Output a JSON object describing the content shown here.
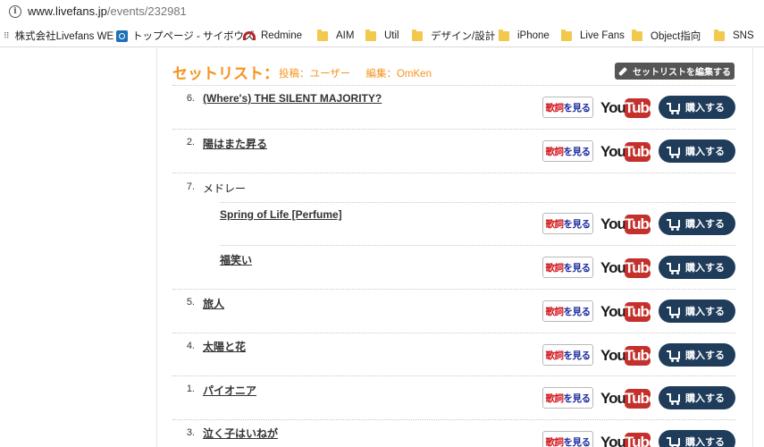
{
  "address_bar": {
    "url_domain": "www.livefans.jp",
    "url_path": "/events/232981"
  },
  "bookmarks": [
    {
      "label": "株式会社Livefans WE",
      "icon": "dots-icon"
    },
    {
      "label": "トップページ - サイボウズ",
      "icon": "cybozu-icon"
    },
    {
      "label": "Redmine",
      "icon": "redmine-icon"
    },
    {
      "label": "AIM",
      "icon": "folder-icon"
    },
    {
      "label": "Util",
      "icon": "folder-icon"
    },
    {
      "label": "デザイン/設計",
      "icon": "folder-icon"
    },
    {
      "label": "iPhone",
      "icon": "folder-icon"
    },
    {
      "label": "Live Fans",
      "icon": "folder-icon"
    },
    {
      "label": "Object指向",
      "icon": "folder-icon"
    },
    {
      "label": "SNS",
      "icon": "folder-icon"
    }
  ],
  "setlist": {
    "title": "セットリスト：",
    "posted": "投稿：ユーザー",
    "edited": "編集：OmKen",
    "edit_button": "セットリストを編集する",
    "lyrics_label_prefix": "歌詞",
    "lyrics_label_suffix": "を見る",
    "youtube_you": "You",
    "youtube_tube": "Tube",
    "buy_label": "購入する",
    "songs": [
      {
        "number": "6.",
        "title": "(Where's) THE SILENT MAJORITY?"
      },
      {
        "number": "2.",
        "title": "陽はまた昇る"
      },
      {
        "number": "7.",
        "title": "メドレー"
      },
      {
        "number": "",
        "title": "Spring of Life [Perfume]"
      },
      {
        "number": "",
        "title": "福笑い"
      },
      {
        "number": "5.",
        "title": "旅人"
      },
      {
        "number": "4.",
        "title": "太陽と花"
      },
      {
        "number": "1.",
        "title": "パイオニア"
      },
      {
        "number": "3.",
        "title": "泣く子はいねが"
      }
    ]
  },
  "colors": {
    "accent": "#f7931e",
    "buy_button": "#1f3c5a",
    "youtube_red": "#c4302b",
    "edit_button": "#555555"
  }
}
